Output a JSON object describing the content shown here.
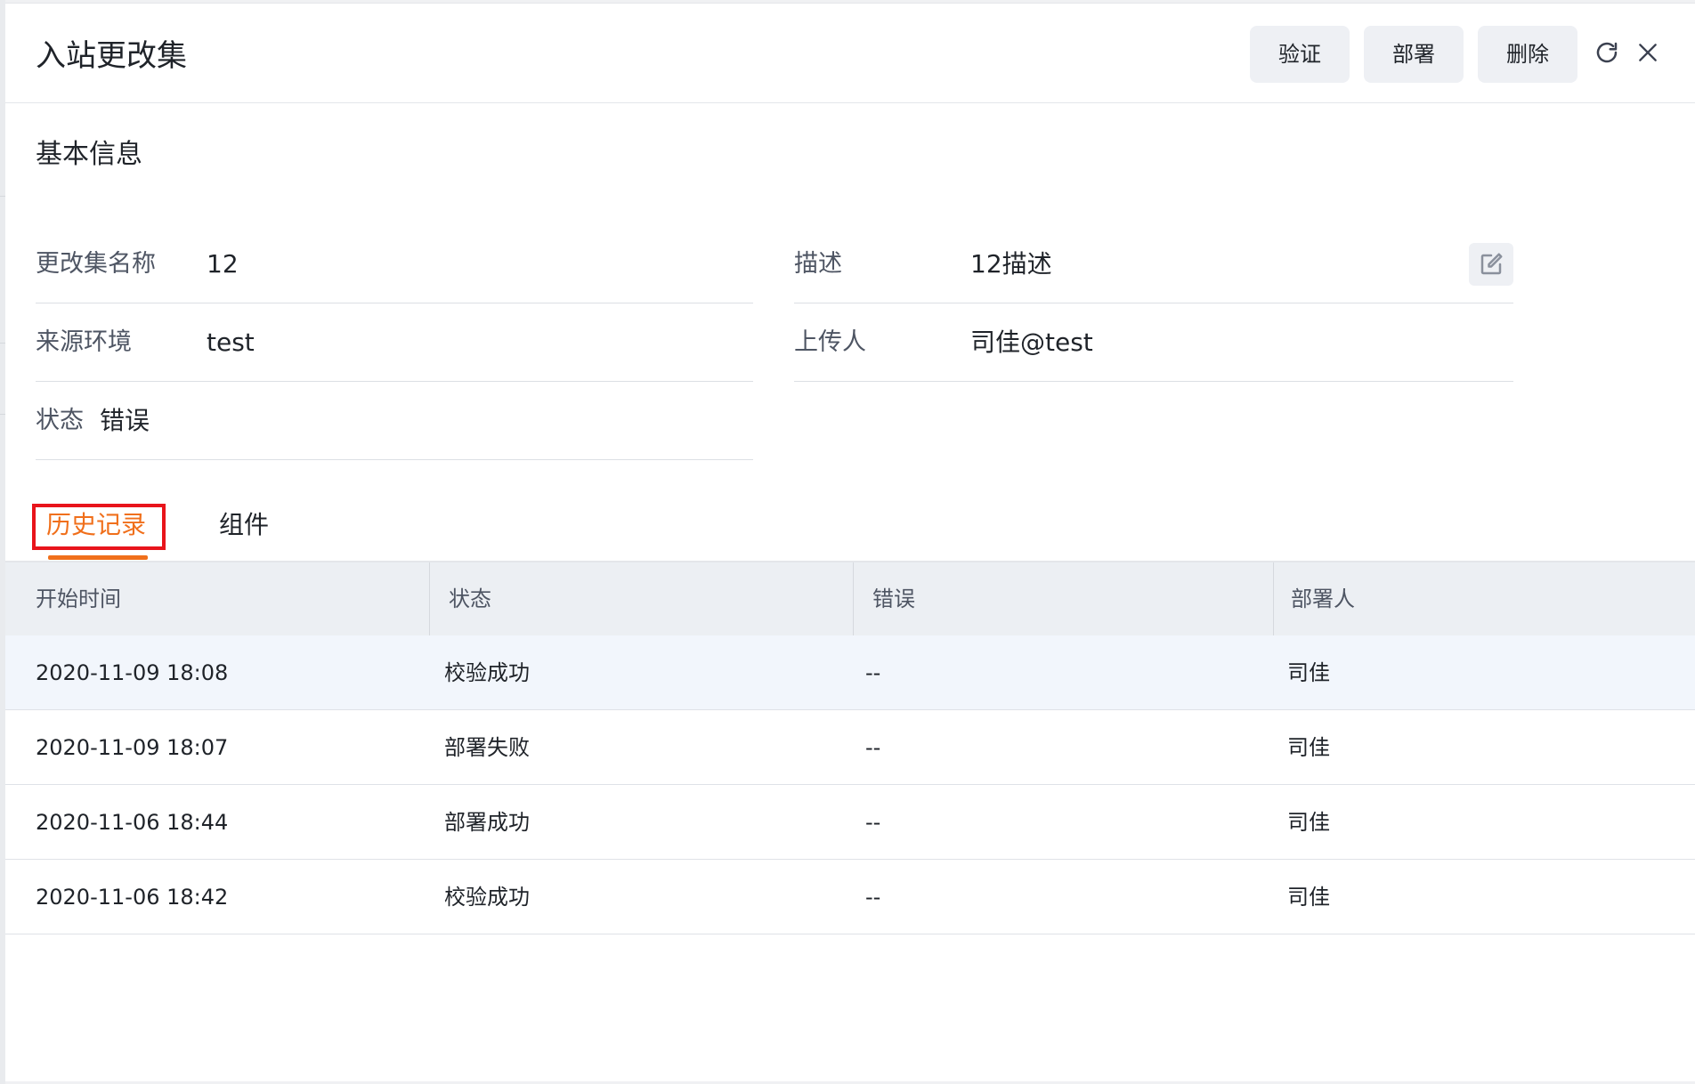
{
  "header": {
    "title": "入站更改集",
    "buttons": {
      "validate": "验证",
      "deploy": "部署",
      "delete": "删除"
    }
  },
  "basic_info": {
    "section_title": "基本信息",
    "fields": {
      "name": {
        "label": "更改集名称",
        "value": "12"
      },
      "description": {
        "label": "描述",
        "value": "12描述"
      },
      "source_env": {
        "label": "来源环境",
        "value": "test"
      },
      "uploader": {
        "label": "上传人",
        "value": "司佳@test"
      },
      "status": {
        "label": "状态",
        "value": "错误"
      }
    }
  },
  "tabs": [
    {
      "label": "历史记录",
      "active": true
    },
    {
      "label": "组件",
      "active": false
    }
  ],
  "history_table": {
    "columns": [
      "开始时间",
      "状态",
      "错误",
      "部署人"
    ],
    "rows": [
      [
        "2020-11-09 18:08",
        "校验成功",
        "--",
        "司佳"
      ],
      [
        "2020-11-09 18:07",
        "部署失败",
        "--",
        "司佳"
      ],
      [
        "2020-11-06 18:44",
        "部署成功",
        "--",
        "司佳"
      ],
      [
        "2020-11-06 18:42",
        "校验成功",
        "--",
        "司佳"
      ]
    ]
  },
  "colors": {
    "accent": "#f06f1b",
    "highlight_box": "#e8141b",
    "header_bg": "#eceff3",
    "button_bg": "#eef0f4"
  },
  "icons": {
    "refresh": "refresh-icon",
    "close": "close-icon",
    "edit": "edit-icon"
  }
}
